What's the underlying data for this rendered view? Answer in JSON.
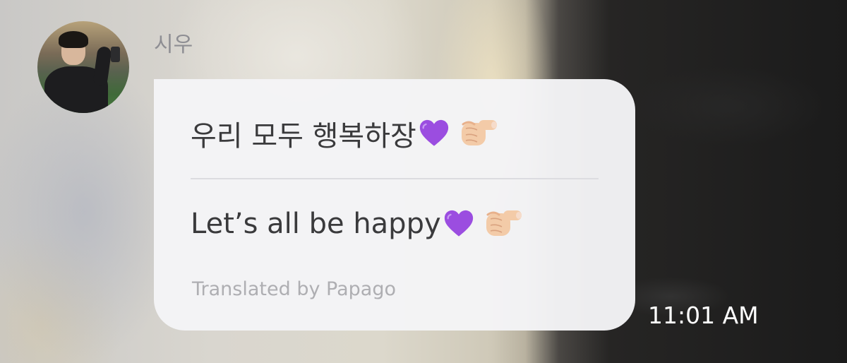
{
  "message": {
    "sender_name": "시우",
    "original_text": "우리 모두 행복하장",
    "translated_text": "Let’s all be happy",
    "translation_credit": "Translated by Papago",
    "timestamp": "11:01 AM",
    "emojis": [
      "purple-heart-icon",
      "pointing-finger-icon"
    ]
  },
  "colors": {
    "bubble": "#f4f4f6",
    "text": "#3a3a3c",
    "sender_name": "#8e8e93",
    "credit": "#aeaeb2",
    "timestamp": "#ffffff",
    "heart": "#9b4de0"
  }
}
